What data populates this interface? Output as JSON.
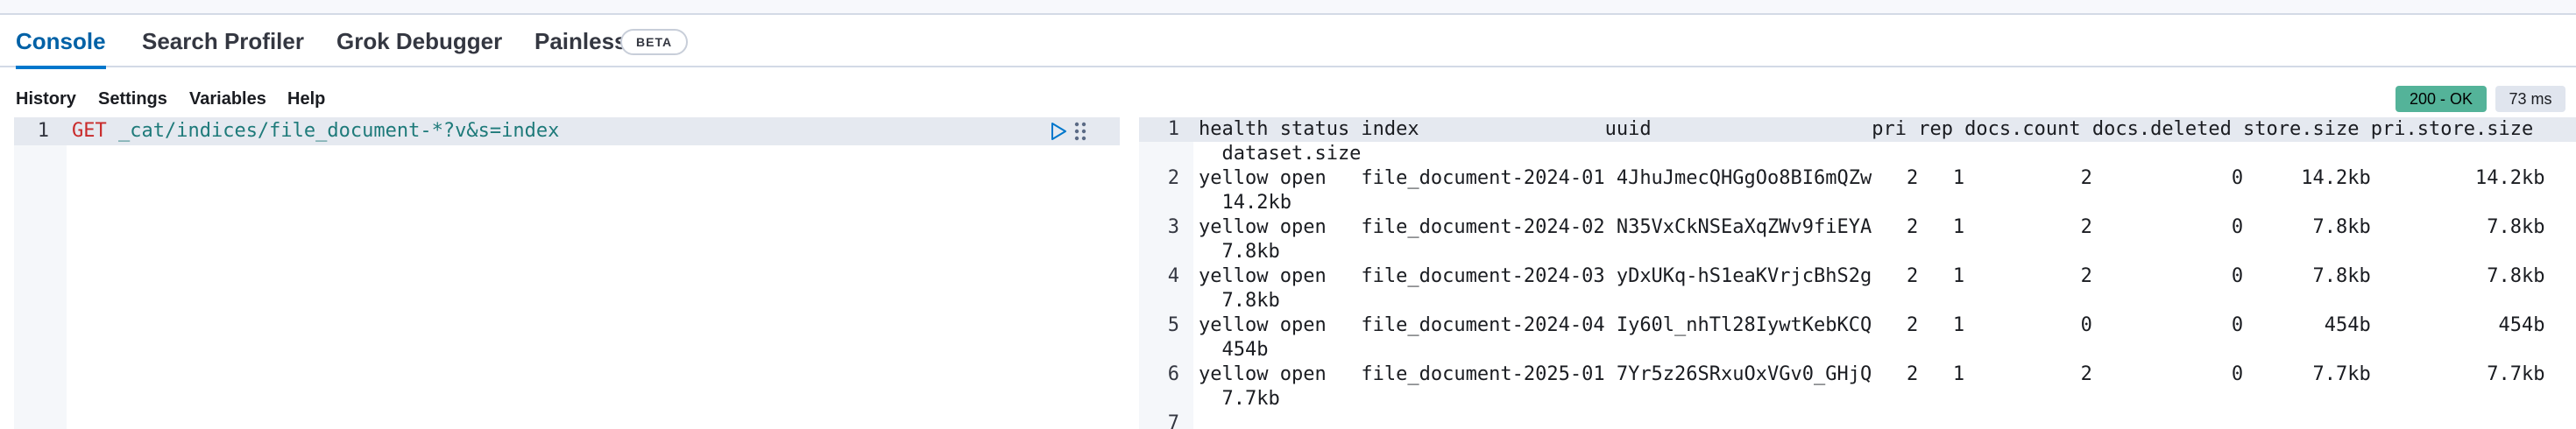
{
  "tabs": [
    {
      "label": "Console"
    },
    {
      "label": "Search Profiler"
    },
    {
      "label": "Grok Debugger"
    },
    {
      "label": "Painless Lab"
    }
  ],
  "beta_label": "BETA",
  "menu": [
    "History",
    "Settings",
    "Variables",
    "Help"
  ],
  "status": {
    "code": "200 - OK",
    "time": "73 ms"
  },
  "editor": {
    "line_number": "1",
    "method": "GET",
    "path": " _cat/indices/file_document-*?v&s=index"
  },
  "output": {
    "line_numbers": [
      "1",
      "2",
      "3",
      "4",
      "5",
      "6",
      "7"
    ],
    "lines": [
      "health status index                uuid                   pri rep docs.count docs.deleted store.size pri.store.size",
      "  dataset.size",
      "yellow open   file_document-2024-01 4JhuJmecQHGgOo8BI6mQZw   2   1          2            0     14.2kb         14.2kb",
      "  14.2kb",
      "yellow open   file_document-2024-02 N35VxCkNSEaXqZWv9fiEYA   2   1          2            0      7.8kb          7.8kb",
      "  7.8kb",
      "yellow open   file_document-2024-03 yDxUKq-hS1eaKVrjcBhS2g   2   1          2            0      7.8kb          7.8kb",
      "  7.8kb",
      "yellow open   file_document-2024-04 Iy60l_nhTl28IywtKebKCQ   2   1          0            0       454b           454b",
      "  454b",
      "yellow open   file_document-2025-01 7Yr5z26SRxuOxVGv0_GHjQ   2   1          2            0      7.7kb          7.7kb",
      "  7.7kb"
    ]
  },
  "colors": {
    "accent": "#0077cc",
    "ok_badge": "#54b399"
  },
  "icons": [
    "play-icon",
    "wrench-icon"
  ]
}
